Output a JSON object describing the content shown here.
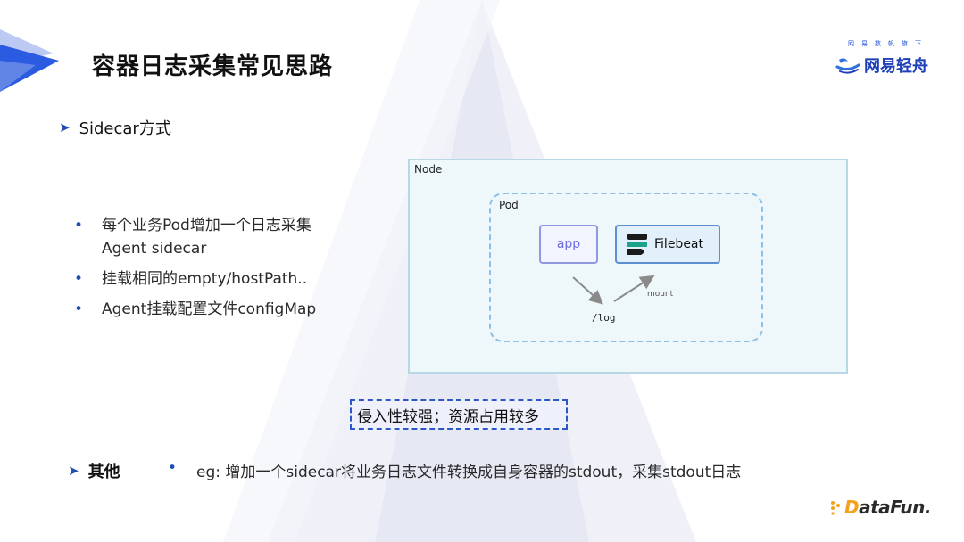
{
  "header": {
    "title": "容器日志采集常见思路"
  },
  "brand": {
    "tagline": "网易数帆旗下",
    "name": "网易轻舟"
  },
  "sections": {
    "sidecar": {
      "label": "Sidecar方式"
    },
    "other": {
      "label": "其他"
    }
  },
  "bullets": [
    "每个业务Pod增加一个日志采集Agent sidecar",
    "挂载相同的empty/hostPath..",
    "Agent挂载配置文件configMap"
  ],
  "other_bullet": "eg: 增加一个sidecar将业务日志文件转换成自身容器的stdout，采集stdout日志",
  "diagram": {
    "node_label": "Node",
    "pod_label": "Pod",
    "app_label": "app",
    "filebeat_label": "Filebeat",
    "log_label": "/log",
    "mount_label": "mount"
  },
  "note": "侵入性较强；资源占用较多",
  "footer_logo": {
    "prefix": "D",
    "rest": "ataFun."
  },
  "colors": {
    "accent": "#1f4fb0",
    "node_bg": "#eef7fa",
    "pod_border": "#8fbfe5",
    "logo_orange": "#f2a21d"
  }
}
